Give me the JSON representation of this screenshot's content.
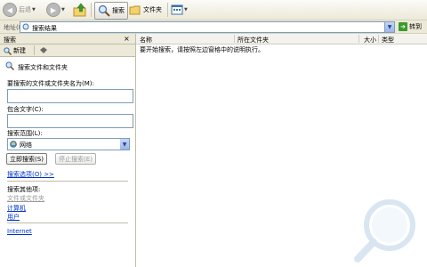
{
  "toolbar": {
    "back_label": "后退",
    "search_label": "搜索",
    "folders_label": "文件夹"
  },
  "address": {
    "label": "地址(D)",
    "value": "搜索结果",
    "go_label": "转到"
  },
  "pane": {
    "title": "搜索",
    "close": "×",
    "new_label": "新建",
    "heading": "搜索文件和文件夹",
    "name_label": "要搜索的文件或文件夹名为(M):",
    "name_value": "",
    "text_label": "包含文字(C):",
    "text_value": "",
    "scope_label": "搜索范围(L):",
    "scope_value": "网络",
    "search_now": "立即搜索(S)",
    "stop_search": "停止搜索(E)",
    "options_label": "搜索选项(O) >>",
    "other_heading": "搜索其他项:",
    "other_items": [
      "文件或文件夹",
      "计算机",
      "用户"
    ],
    "internet_link": "Internet"
  },
  "results": {
    "columns": [
      "名称",
      "所在文件夹",
      "大小",
      "类型"
    ],
    "message": "要开始搜索，请按照左边窗格中的说明执行。"
  },
  "colors": {
    "background": "#ece9d8",
    "link": "#0033cc",
    "go_green": "#3a9b2c"
  },
  "icons": [
    "back-icon",
    "forward-icon",
    "up-folder-icon",
    "search-icon",
    "folders-icon",
    "views-icon",
    "go-icon",
    "new-search-icon",
    "search-dog-icon",
    "network-icon",
    "magnifier-watermark-icon"
  ]
}
